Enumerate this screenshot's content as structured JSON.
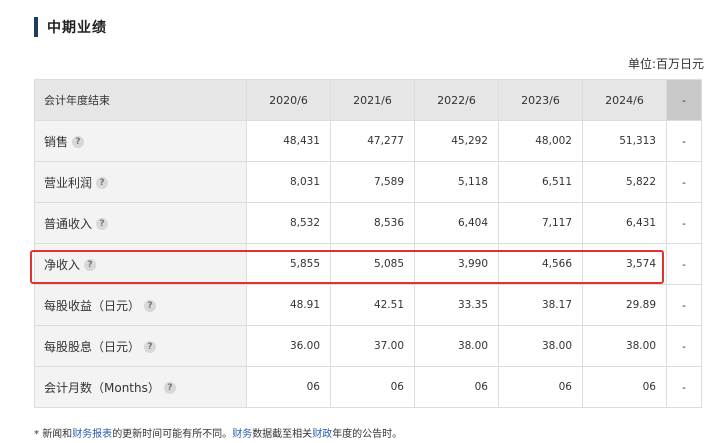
{
  "section": {
    "title": "中期业绩",
    "unit": "单位:百万日元"
  },
  "table": {
    "header": {
      "label": "会计年度结束",
      "years": [
        "2020/6",
        "2021/6",
        "2022/6",
        "2023/6",
        "2024/6"
      ],
      "extra": "-"
    },
    "rows": [
      {
        "label": "销售",
        "values": [
          "48,431",
          "47,277",
          "45,292",
          "48,002",
          "51,313"
        ],
        "extra": "-"
      },
      {
        "label": "营业利润",
        "values": [
          "8,031",
          "7,589",
          "5,118",
          "6,511",
          "5,822"
        ],
        "extra": "-"
      },
      {
        "label": "普通收入",
        "values": [
          "8,532",
          "8,536",
          "6,404",
          "7,117",
          "6,431"
        ],
        "extra": "-"
      },
      {
        "label": "净收入",
        "values": [
          "5,855",
          "5,085",
          "3,990",
          "4,566",
          "3,574"
        ],
        "extra": "-"
      },
      {
        "label": "每股收益（日元）",
        "values": [
          "48.91",
          "42.51",
          "33.35",
          "38.17",
          "29.89"
        ],
        "extra": "-"
      },
      {
        "label": "每股股息（日元）",
        "values": [
          "36.00",
          "37.00",
          "38.00",
          "38.00",
          "38.00"
        ],
        "extra": "-"
      },
      {
        "label": "会计月数（Months）",
        "values": [
          "06",
          "06",
          "06",
          "06",
          "06"
        ],
        "extra": "-"
      }
    ]
  },
  "help_glyph": "?",
  "footnote": {
    "star": "*",
    "p1": "新闻和",
    "link1": "财务报表",
    "p2": "的更新时间可能有所不同。",
    "link2": "财务",
    "p3": "数据截至相关",
    "link3": "财政",
    "p4": "年度的公告时。"
  }
}
